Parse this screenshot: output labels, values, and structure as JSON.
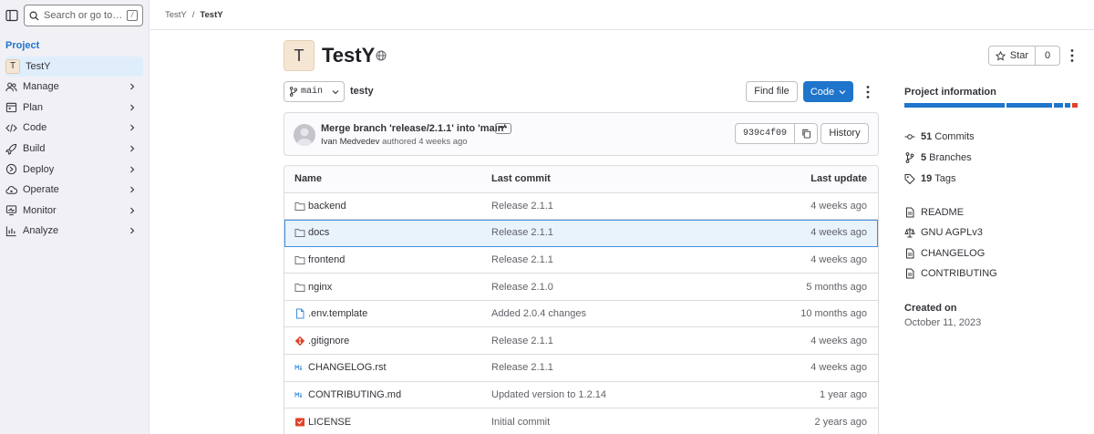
{
  "sidebar": {
    "search_placeholder": "Search or go to…",
    "kbd_hint": "/",
    "section": "Project",
    "project": {
      "avatar": "T",
      "name": "TestY"
    },
    "items": [
      {
        "label": "Manage",
        "icon": "users-icon"
      },
      {
        "label": "Plan",
        "icon": "calendar-icon"
      },
      {
        "label": "Code",
        "icon": "code-icon"
      },
      {
        "label": "Build",
        "icon": "rocket-icon"
      },
      {
        "label": "Deploy",
        "icon": "deploy-icon"
      },
      {
        "label": "Operate",
        "icon": "cloud-gear-icon"
      },
      {
        "label": "Monitor",
        "icon": "monitor-icon"
      },
      {
        "label": "Analyze",
        "icon": "chart-icon"
      }
    ]
  },
  "breadcrumb": {
    "parent": "TestY",
    "separator": "/",
    "current": "TestY"
  },
  "project": {
    "avatar": "T",
    "title": "TestY",
    "visibility_icon": "globe-icon"
  },
  "star": {
    "label": "Star",
    "count": "0"
  },
  "branch": {
    "name": "main",
    "path": "testy"
  },
  "actions": {
    "find_file": "Find file",
    "code": "Code"
  },
  "last_commit": {
    "message": "Merge branch 'release/2.1.1' into 'main'",
    "ellipsis": "•••",
    "author": "Ivan Medvedev",
    "authored": "authored",
    "time": "4 weeks ago",
    "sha": "939c4f09",
    "history": "History"
  },
  "table": {
    "headers": {
      "name": "Name",
      "last_commit": "Last commit",
      "last_update": "Last update"
    },
    "rows": [
      {
        "name": "backend",
        "icon": "folder-icon",
        "commit": "Release 2.1.1",
        "updated": "4 weeks ago"
      },
      {
        "name": "docs",
        "icon": "folder-icon",
        "commit": "Release 2.1.1",
        "updated": "4 weeks ago"
      },
      {
        "name": "frontend",
        "icon": "folder-icon",
        "commit": "Release 2.1.1",
        "updated": "4 weeks ago"
      },
      {
        "name": "nginx",
        "icon": "folder-icon",
        "commit": "Release 2.1.0",
        "updated": "5 months ago"
      },
      {
        "name": ".env.template",
        "icon": "file-icon",
        "commit": "Added 2.0.4 changes",
        "updated": "10 months ago"
      },
      {
        "name": ".gitignore",
        "icon": "git-icon",
        "commit": "Release 2.1.1",
        "updated": "4 weeks ago"
      },
      {
        "name": "CHANGELOG.rst",
        "icon": "markdown-icon",
        "commit": "Release 2.1.1",
        "updated": "4 weeks ago"
      },
      {
        "name": "CONTRIBUTING.md",
        "icon": "markdown-icon",
        "commit": "Updated version to 1.2.14",
        "updated": "1 year ago"
      },
      {
        "name": "LICENSE",
        "icon": "license-icon",
        "commit": "Initial commit",
        "updated": "2 years ago"
      }
    ]
  },
  "project_info": {
    "title": "Project information",
    "language_bar_colors": [
      "#1f75cb",
      "#1f75cb",
      "#1f75cb",
      "#1f75cb",
      "#e24329"
    ],
    "stats": [
      {
        "count": "51",
        "label": "Commits",
        "icon": "commit-icon"
      },
      {
        "count": "5",
        "label": "Branches",
        "icon": "branch-icon"
      },
      {
        "count": "19",
        "label": "Tags",
        "icon": "tag-icon"
      }
    ],
    "links": [
      {
        "label": "README",
        "icon": "doc-icon"
      },
      {
        "label": "GNU AGPLv3",
        "icon": "scale-icon"
      },
      {
        "label": "CHANGELOG",
        "icon": "doc-icon"
      },
      {
        "label": "CONTRIBUTING",
        "icon": "doc-icon"
      }
    ],
    "created_label": "Created on",
    "created_date": "October 11, 2023"
  }
}
